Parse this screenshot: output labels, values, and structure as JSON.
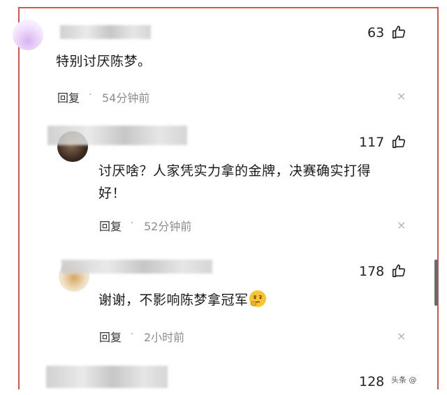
{
  "comments": [
    {
      "likes": "63",
      "text": "特别讨厌陈梦。",
      "reply": "回复",
      "time": "54分钟前"
    },
    {
      "likes": "117",
      "text_line1": "讨厌啥？人家凭实力拿的金牌，决赛确实打得",
      "text_line2": "好！",
      "reply": "回复",
      "time": "52分钟前"
    },
    {
      "likes": "178",
      "text": "谢谢，不影响陈梦拿冠军",
      "emoji": "thinking-face-emoji",
      "reply": "回复",
      "time": "2小时前"
    },
    {
      "likes": "128"
    }
  ],
  "separator": "·",
  "close_symbol": "×",
  "watermark": "头条 @"
}
